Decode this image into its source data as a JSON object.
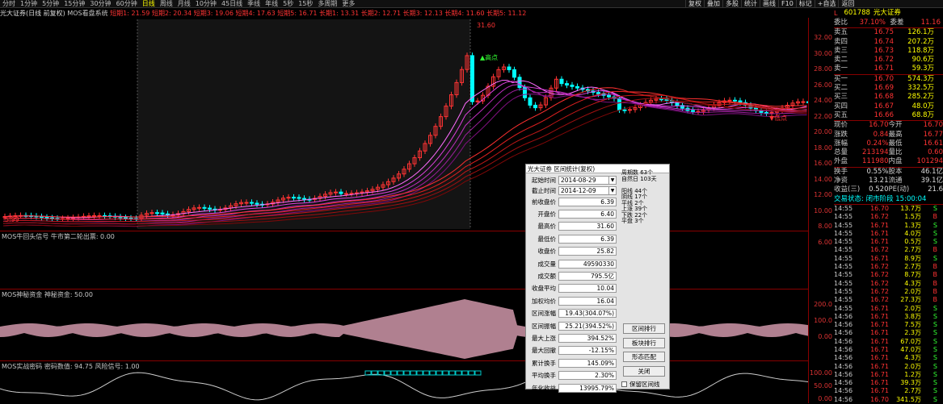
{
  "topbar": {
    "items": [
      "分时",
      "1分钟",
      "5分钟",
      "15分钟",
      "30分钟",
      "60分钟",
      "日线",
      "周线",
      "月线",
      "10分钟",
      "45日线",
      "季线",
      "年线",
      "5秒",
      "15秒",
      "多周期",
      "更多"
    ],
    "active_index": 6,
    "right_buttons": [
      "复权",
      "叠加",
      "多股",
      "统计",
      "画线",
      "F10",
      "标记",
      "+自选",
      "返回"
    ]
  },
  "chart_info": {
    "title": "光大证券(日线 前复权)",
    "indicator": "MOS看盘系统",
    "values": "短期1: 21.59 短期2: 20.34 短期3: 19.06 短期4: 17.63 短期5: 16.71 长期1: 13.31 长期2: 12.71 长期3: 12.13 长期4: 11.60 长期5: 11.12"
  },
  "main_chart": {
    "high_label": "31.60",
    "low_label": "5.99",
    "mark_high": "▲高点",
    "mark_low": "▼低点",
    "mark_mid": "▲高点"
  },
  "axis_main": [
    "32.00",
    "30.00",
    "28.00",
    "26.00",
    "24.00",
    "22.00",
    "20.00",
    "18.00",
    "16.00",
    "14.00",
    "12.00",
    "10.00",
    "8.00",
    "6.00"
  ],
  "axis_mid": [
    "200.0",
    "100.0",
    "0.00"
  ],
  "axis_bot": [
    "100.00",
    "50.00",
    "0.00"
  ],
  "ind1": {
    "label": "MOS牛回头信号 牛市第二轮出票: 0.00"
  },
  "ind2": {
    "label": "MOS神秘资金 神秘资金: 50.00"
  },
  "ind3": {
    "label": "MOS实战密码 密码数值: 94.75 风险信号: 1.00"
  },
  "quote": {
    "code": "601788",
    "name": "光大证券",
    "webi": "37.10%",
    "weicha": "11.16",
    "asks": [
      [
        "卖五",
        "16.75",
        "126.1万"
      ],
      [
        "卖四",
        "16.74",
        "207.2万"
      ],
      [
        "卖三",
        "16.73",
        "118.8万"
      ],
      [
        "卖二",
        "16.72",
        "90.6万"
      ],
      [
        "卖一",
        "16.71",
        "59.3万"
      ]
    ],
    "bids": [
      [
        "买一",
        "16.70",
        "574.3万"
      ],
      [
        "买二",
        "16.69",
        "332.5万"
      ],
      [
        "买三",
        "16.68",
        "285.2万"
      ],
      [
        "买四",
        "16.67",
        "48.0万"
      ],
      [
        "买五",
        "16.66",
        "68.8万"
      ]
    ],
    "stats": [
      [
        "现价",
        "16.70",
        "今开",
        "16.70"
      ],
      [
        "涨跌",
        "0.84",
        "最高",
        "16.77"
      ],
      [
        "涨幅",
        "0.24%",
        "最低",
        "16.61"
      ],
      [
        "总量",
        "213194",
        "量比",
        "0.60"
      ],
      [
        "外盘",
        "111980",
        "内盘",
        "101294"
      ]
    ],
    "stats2": [
      [
        "换手",
        "0.55%",
        "股本",
        "46.1亿"
      ],
      [
        "净资",
        "13.21",
        "流通",
        "39.1亿"
      ],
      [
        "收益(三)",
        "0.520",
        "PE(动)",
        "21.6"
      ]
    ],
    "status": "交易状态: 闭市阶段 15:00:04",
    "ticks": [
      [
        "14:55",
        "16.70",
        "13.7万",
        "S"
      ],
      [
        "14:55",
        "16.72",
        "1.5万",
        "B"
      ],
      [
        "14:55",
        "16.71",
        "1.3万",
        "S"
      ],
      [
        "14:55",
        "16.71",
        "4.0万",
        "S"
      ],
      [
        "14:55",
        "16.71",
        "0.5万",
        "S"
      ],
      [
        "14:55",
        "16.72",
        "2.7万",
        "B"
      ],
      [
        "14:55",
        "16.71",
        "8.9万",
        "S"
      ],
      [
        "14:55",
        "16.72",
        "2.7万",
        "B"
      ],
      [
        "14:55",
        "16.72",
        "8.7万",
        "B"
      ],
      [
        "14:55",
        "16.72",
        "4.3万",
        "B"
      ],
      [
        "14:55",
        "16.72",
        "2.0万",
        "B"
      ],
      [
        "14:55",
        "16.72",
        "27.3万",
        "B"
      ],
      [
        "14:55",
        "16.71",
        "2.0万",
        "S"
      ],
      [
        "14:56",
        "16.71",
        "3.8万",
        "S"
      ],
      [
        "14:56",
        "16.71",
        "7.5万",
        "S"
      ],
      [
        "14:56",
        "16.71",
        "2.3万",
        "S"
      ],
      [
        "14:56",
        "16.71",
        "67.0万",
        "S"
      ],
      [
        "14:56",
        "16.71",
        "47.0万",
        "S"
      ],
      [
        "14:56",
        "16.71",
        "4.3万",
        "S"
      ],
      [
        "14:56",
        "16.71",
        "2.0万",
        "S"
      ],
      [
        "14:56",
        "16.71",
        "1.2万",
        "S"
      ],
      [
        "14:56",
        "16.71",
        "39.3万",
        "S"
      ],
      [
        "14:56",
        "16.71",
        "2.7万",
        "S"
      ],
      [
        "14:56",
        "16.70",
        "341.5万",
        "S"
      ]
    ]
  },
  "dialog": {
    "title": "光大证券 区间统计(复权)",
    "start_label": "起始时间",
    "start": "2014-08-29",
    "end_label": "截止时间",
    "end": "2014-12-09",
    "fields": [
      [
        "前收盘价",
        "6.39"
      ],
      [
        "开盘价",
        "6.40"
      ],
      [
        "最高价",
        "31.60"
      ],
      [
        "最低价",
        "6.39"
      ],
      [
        "收盘价",
        "25.82"
      ],
      [
        "成交量",
        "49590330"
      ],
      [
        "成交额",
        "795.5亿"
      ],
      [
        "收盘平均",
        "10.04"
      ],
      [
        "加权均价",
        "16.04"
      ],
      [
        "区间涨幅",
        "19.43(304.07%)"
      ],
      [
        "区间振幅",
        "25.21(394.52%)"
      ],
      [
        "最大上涨",
        "394.52%"
      ],
      [
        "最大回撤",
        "-12.15%"
      ],
      [
        "累计换手",
        "145.09%"
      ],
      [
        "平均换手",
        "2.30%"
      ],
      [
        "年化收益",
        "13995.79%"
      ]
    ],
    "stats_text": "周期数 63个\n自然日 103天\n\n阳线 44个\n阴线 17个\n平线 2个\n上涨 39个\n下跌 22个\n平盘 3个",
    "buttons": [
      "区间排行",
      "板块排行",
      "形态匹配",
      "关闭"
    ],
    "checkbox": "保留区间线"
  }
}
